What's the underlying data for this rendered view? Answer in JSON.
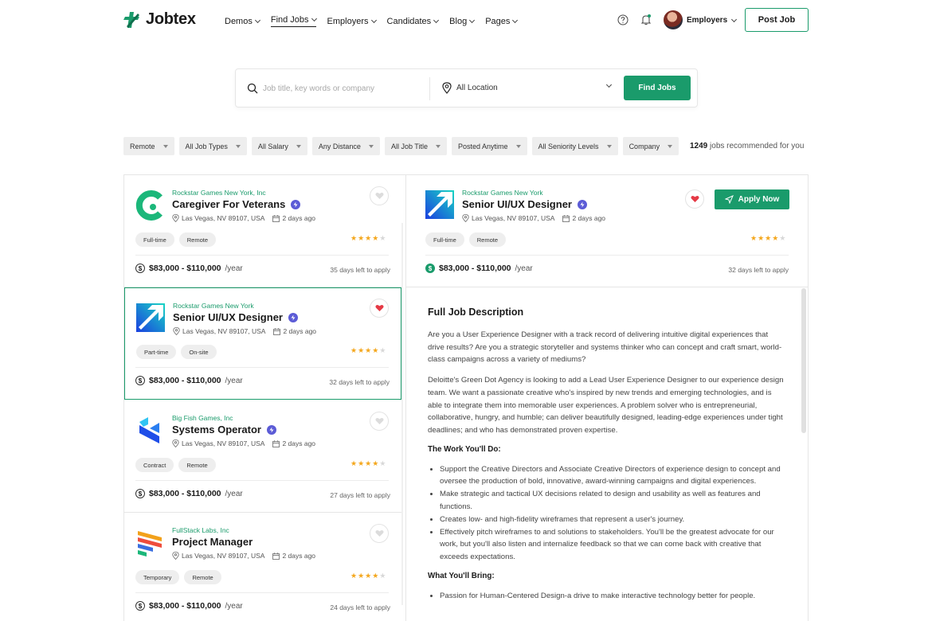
{
  "brand": {
    "name": "Jobtex",
    "accent": "#1a9b6b"
  },
  "nav": [
    {
      "label": "Demos",
      "active": false
    },
    {
      "label": "Find Jobs",
      "active": true
    },
    {
      "label": "Employers",
      "active": false
    },
    {
      "label": "Candidates",
      "active": false
    },
    {
      "label": "Blog",
      "active": false
    },
    {
      "label": "Pages",
      "active": false
    }
  ],
  "header": {
    "account_label": "Employers",
    "post_job": "Post Job",
    "icons": [
      "help-icon",
      "bell-icon"
    ]
  },
  "search": {
    "placeholder": "Job title, key words or company",
    "location": "All Location",
    "button": "Find Jobs"
  },
  "filters": [
    "Remote",
    "All Job Types",
    "All Salary",
    "Any Distance",
    "All Job Title",
    "Posted Anytime",
    "All Seniority Levels",
    "Company"
  ],
  "results": {
    "count": "1249",
    "suffix": "jobs recommended for you"
  },
  "jobs": [
    {
      "company": "Rockstar Games New York, Inc",
      "title": "Caregiver For Veterans",
      "location": "Las Vegas, NV 89107, USA",
      "posted": "2 days ago",
      "tags": [
        "Full-time",
        "Remote"
      ],
      "rating": 4,
      "salary": "$83,000 - $110,000",
      "period": "/year",
      "days_left": "35 days left to apply",
      "saved": false,
      "logo": "green-c-logo"
    },
    {
      "company": "Rockstar Games New York",
      "title": "Senior UI/UX Designer",
      "location": "Las Vegas, NV 89107, USA",
      "posted": "2 days ago",
      "tags": [
        "Part-time",
        "On-site"
      ],
      "rating": 4,
      "salary": "$83,000 - $110,000",
      "period": "/year",
      "days_left": "32 days left to apply",
      "saved": true,
      "logo": "arrow-logo"
    },
    {
      "company": "Big Fish Games, Inc",
      "title": "Systems Operator",
      "location": "Las Vegas, NV 89107, USA",
      "posted": "2 days ago",
      "tags": [
        "Contract",
        "Remote"
      ],
      "rating": 4,
      "salary": "$83,000 - $110,000",
      "period": "/year",
      "days_left": "27 days left to apply",
      "saved": false,
      "logo": "blue-cube-logo"
    },
    {
      "company": "FullStack Labs, Inc",
      "title": "Project Manager",
      "location": "Las Vegas, NV 89107, USA",
      "posted": "2 days ago",
      "tags": [
        "Temporary",
        "Remote"
      ],
      "rating": 4,
      "salary": "$83,000 - $110,000",
      "period": "/year",
      "days_left": "24 days left to apply",
      "saved": false,
      "logo": "stripes-logo"
    }
  ],
  "detail": {
    "company": "Rockstar Games New York",
    "title": "Senior UI/UX Designer",
    "location": "Las Vegas, NV 89107, USA",
    "posted": "2 days ago",
    "tags": [
      "Full-time",
      "Remote"
    ],
    "rating": 4,
    "salary": "$83,000 - $110,000",
    "period": "/year",
    "days_left": "32 days left to apply",
    "apply": "Apply Now",
    "heading": "Full Job Description",
    "paragraphs": [
      "Are you a User Experience Designer with a track record of delivering intuitive digital experiences that drive results? Are you a strategic storyteller and systems thinker who can concept and craft smart, world-class campaigns across a variety of mediums?",
      "Deloitte's Green Dot Agency is looking to add a Lead User Experience Designer to our experience design team. We want a passionate creative who's inspired by new trends and emerging technologies, and is able to integrate them into memorable user experiences. A problem solver who is entrepreneurial, collaborative, hungry, and humble; can deliver beautifully designed, leading-edge experiences under tight deadlines; and who has demonstrated proven expertise."
    ],
    "work_heading": "The Work You'll Do:",
    "work_items": [
      "Support the Creative Directors and Associate Creative Directors of experience design to concept and oversee the production of bold, innovative, award-winning campaigns and digital experiences.",
      "Make strategic and tactical UX decisions related to design and usability as well as features and functions.",
      "Creates low- and high-fidelity wireframes that represent a user's journey.",
      "Effectively pitch wireframes to and solutions to stakeholders. You'll be the greatest advocate for our work, but you'll also listen and internalize feedback so that we can come back with creative that exceeds expectations."
    ],
    "bring_heading": "What You'll Bring:",
    "bring_items": [
      "Passion for Human-Centered Design-a drive to make interactive technology better for people."
    ]
  }
}
